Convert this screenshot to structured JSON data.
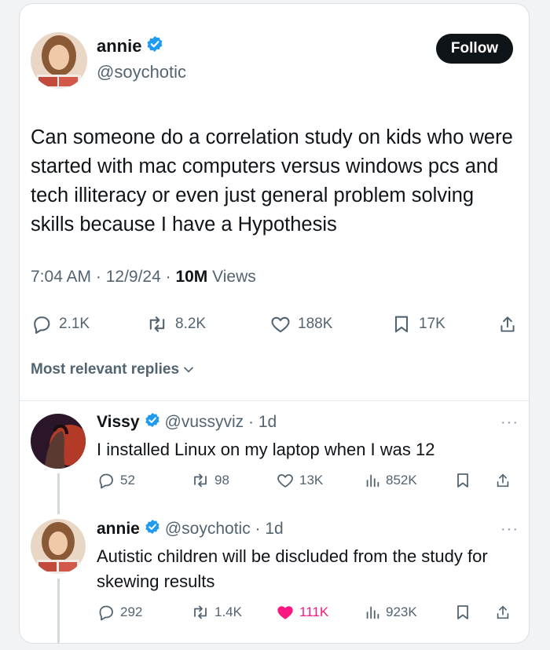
{
  "tweet": {
    "name": "annie",
    "handle": "@soychotic",
    "follow_label": "Follow",
    "text": "Can someone do a correlation study on kids who were started with mac computers versus windows pcs and tech illiteracy or even just general problem solving skills because I have a Hypothesis",
    "time": "7:04 AM · 12/9/24 · ",
    "views_count": "10M",
    "views_label": " Views",
    "stats": {
      "replies": "2.1K",
      "reposts": "8.2K",
      "likes": "188K",
      "bookmarks": "17K"
    }
  },
  "replies_header": "Most relevant replies",
  "replies": [
    {
      "name": "Vissy",
      "handle_time": "@vussyviz · 1d",
      "text": "I installed Linux on my laptop when I was 12",
      "stats": {
        "replies": "52",
        "reposts": "98",
        "likes": "13K",
        "views": "852K"
      },
      "liked": false
    },
    {
      "name": "annie",
      "handle_time": "@soychotic · 1d",
      "text": "Autistic children will be discluded from the study for skewing results",
      "stats": {
        "replies": "292",
        "reposts": "1.4K",
        "likes": "111K",
        "views": "923K"
      },
      "liked": true
    }
  ],
  "colors": {
    "accent": "#1d9bf0",
    "like": "#f91880",
    "text": "#0f1419",
    "muted": "#536471"
  }
}
